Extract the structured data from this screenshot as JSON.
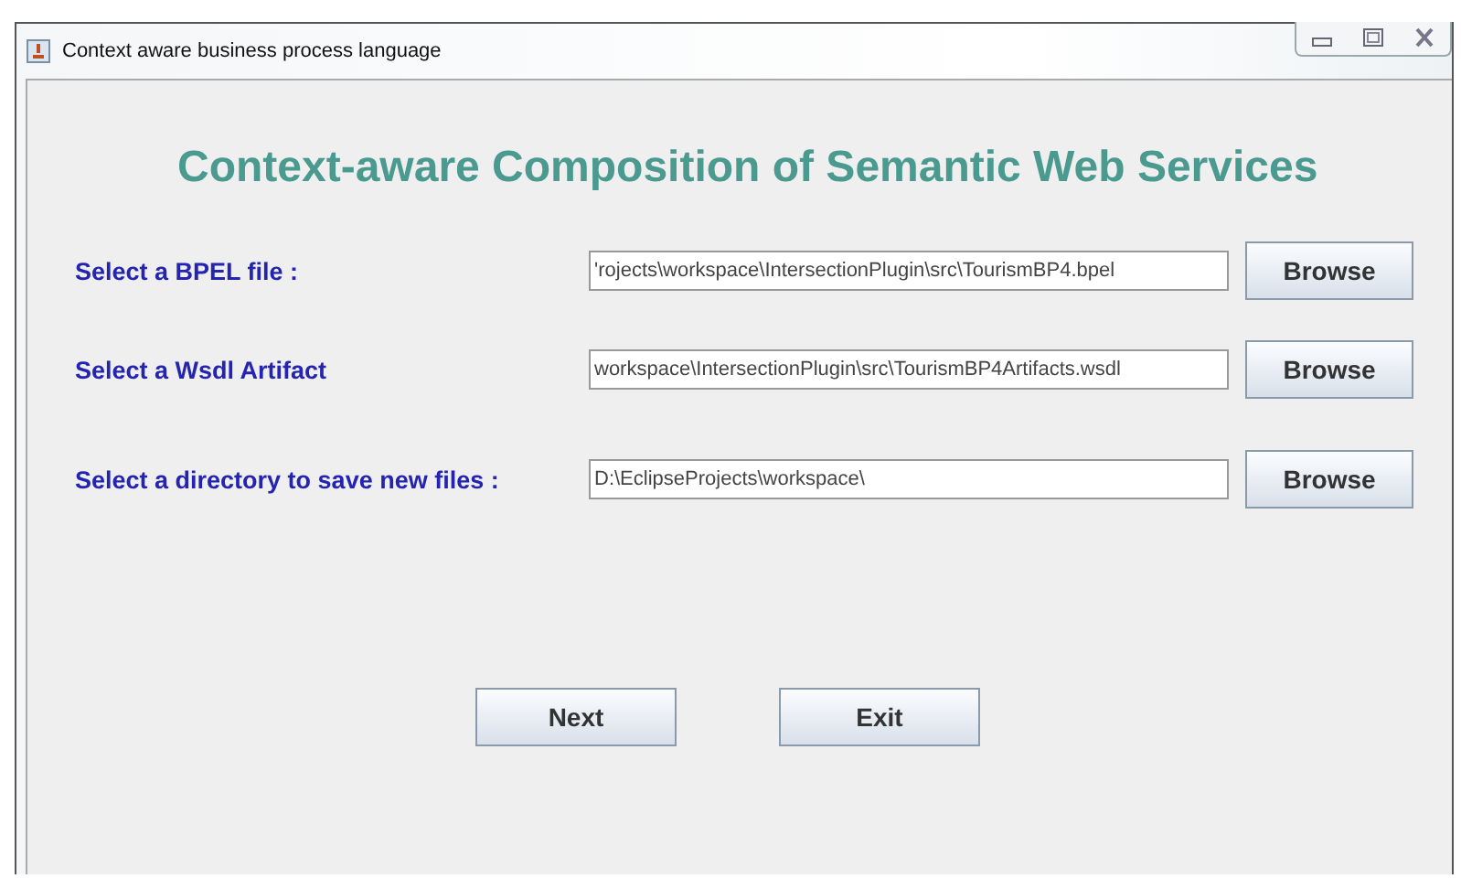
{
  "window": {
    "title": "Context aware business process language"
  },
  "heading": "Context-aware Composition of Semantic Web Services",
  "rows": [
    {
      "label": "Select a BPEL file :",
      "value": "'rojects\\workspace\\IntersectionPlugin\\src\\TourismBP4.bpel",
      "button": "Browse"
    },
    {
      "label": "Select a Wsdl Artifact",
      "value": "workspace\\IntersectionPlugin\\src\\TourismBP4Artifacts.wsdl",
      "button": "Browse"
    },
    {
      "label": "Select a directory to save new files :",
      "value": "D:\\EclipseProjects\\workspace\\",
      "button": "Browse"
    }
  ],
  "buttons": [
    "Next",
    "Exit"
  ]
}
